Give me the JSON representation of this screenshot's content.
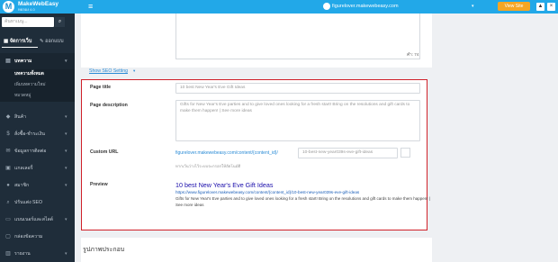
{
  "header": {
    "brand": "MakeWebEasy",
    "brand_sub": "ทดลอง 4.0",
    "user_email": "figurelover.makewebeasy.com",
    "view_site": "View Site",
    "icons": [
      "bell-icon",
      "close-icon"
    ]
  },
  "sidebar": {
    "search_placeholder": "ค้นหาเมนู...",
    "tabs": [
      "จัดการเว็บ",
      "ออกแบบ"
    ],
    "items": [
      {
        "label": "บทความ",
        "icon": "doc-icon"
      },
      {
        "label": "สินค้า",
        "icon": "cart-icon"
      },
      {
        "label": "สั่งซื้อ-ชำระเงิน",
        "icon": "order-icon"
      },
      {
        "label": "ข้อมูลการติดต่อ",
        "icon": "contact-icon"
      },
      {
        "label": "แกลเลอรี่",
        "icon": "gallery-icon"
      },
      {
        "label": "สมาชิก",
        "icon": "member-icon"
      },
      {
        "label": "ปรับแต่ง SEO",
        "icon": "seo-icon"
      },
      {
        "label": "แบนเนอร์และสไลด์",
        "icon": "banner-icon"
      },
      {
        "label": "กล่องข้อความ",
        "icon": "box-icon"
      },
      {
        "label": "รายงาน",
        "icon": "report-icon"
      }
    ],
    "subitems": [
      "บทความทั้งหมด",
      "เพิ่มบทความใหม่",
      "หมวดหมู่"
    ]
  },
  "content": {
    "counter": "คำ: 74",
    "show_seo": "Show SEO Setting",
    "seo": {
      "page_title_label": "Page title",
      "page_title_value": "10 best New Year's Eve Gift Ideas",
      "page_desc_label": "Page description",
      "page_desc_value": "Gifts for New Year's Eve parties and to give loved ones looking for a fresh start! Bring on the resolutions and gift cards to make them happen! | See more ideas",
      "custom_url_label": "Custom URL",
      "custom_url_base": "figurelover.makewebeasy.com/content/{content_id}/",
      "custom_url_value": "10-best-new-year039s-eve-gift-ideas",
      "custom_url_note": "หากเว้นว่างไว้ระบบจะกรอกให้อัตโนมัติ",
      "preview_label": "Preview",
      "preview_title": "10 best New Year's Eve Gift Ideas",
      "preview_url": "https://www.figurelover.makewebeasy.com/content/{content_id}/10-best-new-year039s-eve-gift-ideas",
      "preview_desc": "Gifts for New Year's Eve parties and to give loved ones looking for a fresh start! Bring on the resolutions and gift cards to make them happen! | See more ideas"
    },
    "bottom_section_title": "รูปภาพประกอบ"
  },
  "colors": {
    "topbar": "#22a8e8",
    "sidebar": "#1f2d3a",
    "highlight_border": "#d0212a",
    "link": "#2a8bd6",
    "view_site": "#f5a623"
  }
}
